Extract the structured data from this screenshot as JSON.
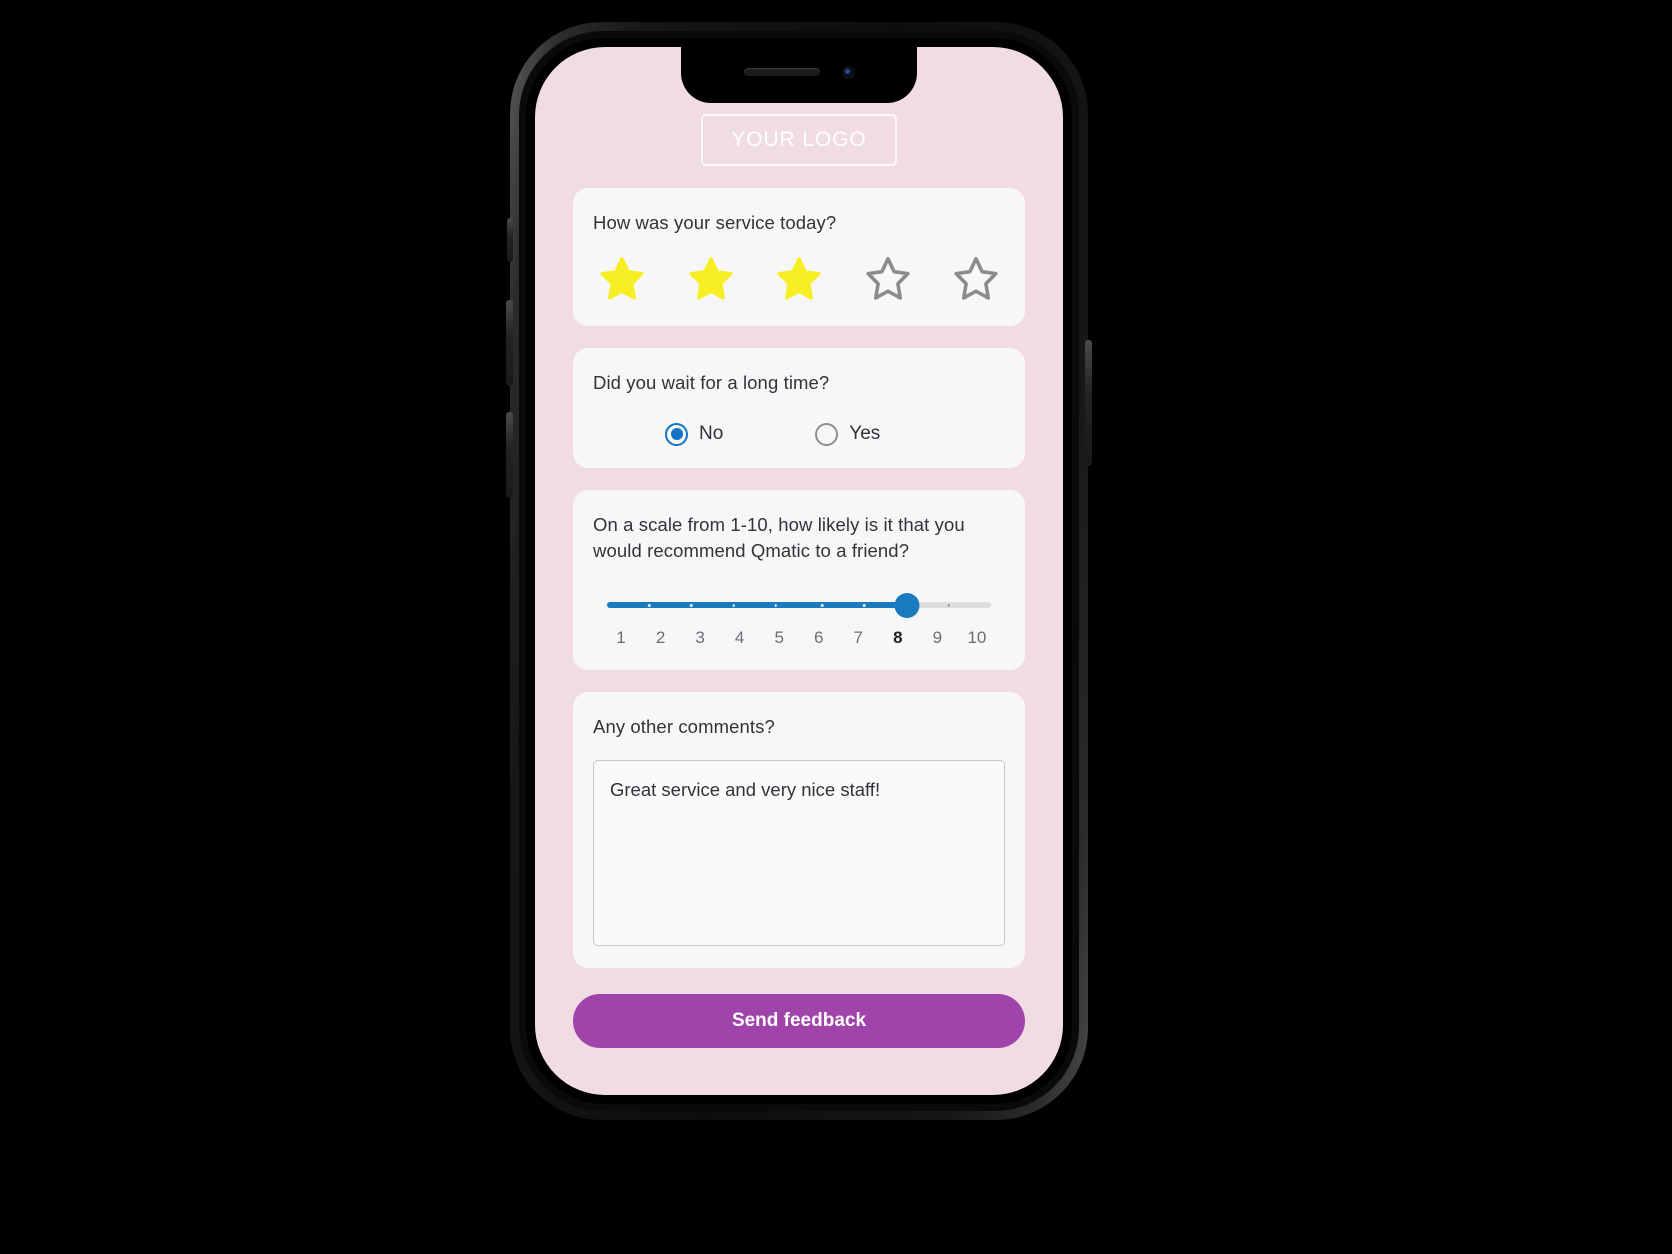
{
  "device": {
    "type": "smartphone-mockup",
    "notch": {
      "speaker": "speaker-grille",
      "camera": "front-camera"
    },
    "buttons": [
      "mute-switch",
      "volume-up",
      "volume-down",
      "power"
    ]
  },
  "colors": {
    "screen_background": "#f0dce2",
    "card_background": "#f8f7f7",
    "accent_blue": "#1a7ac0",
    "star_filled": "#f7ee23",
    "star_empty": "#8b8b8b",
    "submit_purple": "#a044ab",
    "text_primary": "#32323a",
    "frame_black": "#0d0d0e"
  },
  "header": {
    "logo_text": "YOUR LOGO"
  },
  "cards": [
    {
      "id": "service-rating",
      "question": "How was your service today?",
      "type": "star-rating",
      "max": 5,
      "value": 3,
      "stars": [
        "filled",
        "filled",
        "filled",
        "empty",
        "empty"
      ]
    },
    {
      "id": "wait-time",
      "question": "Did you wait for a long time?",
      "type": "radio-group",
      "selected": "No",
      "options": [
        {
          "label": "No",
          "selected": true
        },
        {
          "label": "Yes",
          "selected": false
        }
      ]
    },
    {
      "id": "nps-score",
      "question": "On a scale from 1-10, how likely is it that you would recommend Qmatic to a friend?",
      "type": "slider",
      "min": 1,
      "max": 10,
      "value": 8,
      "scale_labels": [
        "1",
        "2",
        "3",
        "4",
        "5",
        "6",
        "7",
        "8",
        "9",
        "10"
      ]
    },
    {
      "id": "comments",
      "question": "Any other comments?",
      "type": "textarea",
      "value": "Great service and very nice staff!",
      "placeholder": ""
    }
  ],
  "footer": {
    "submit_label": "Send feedback"
  }
}
